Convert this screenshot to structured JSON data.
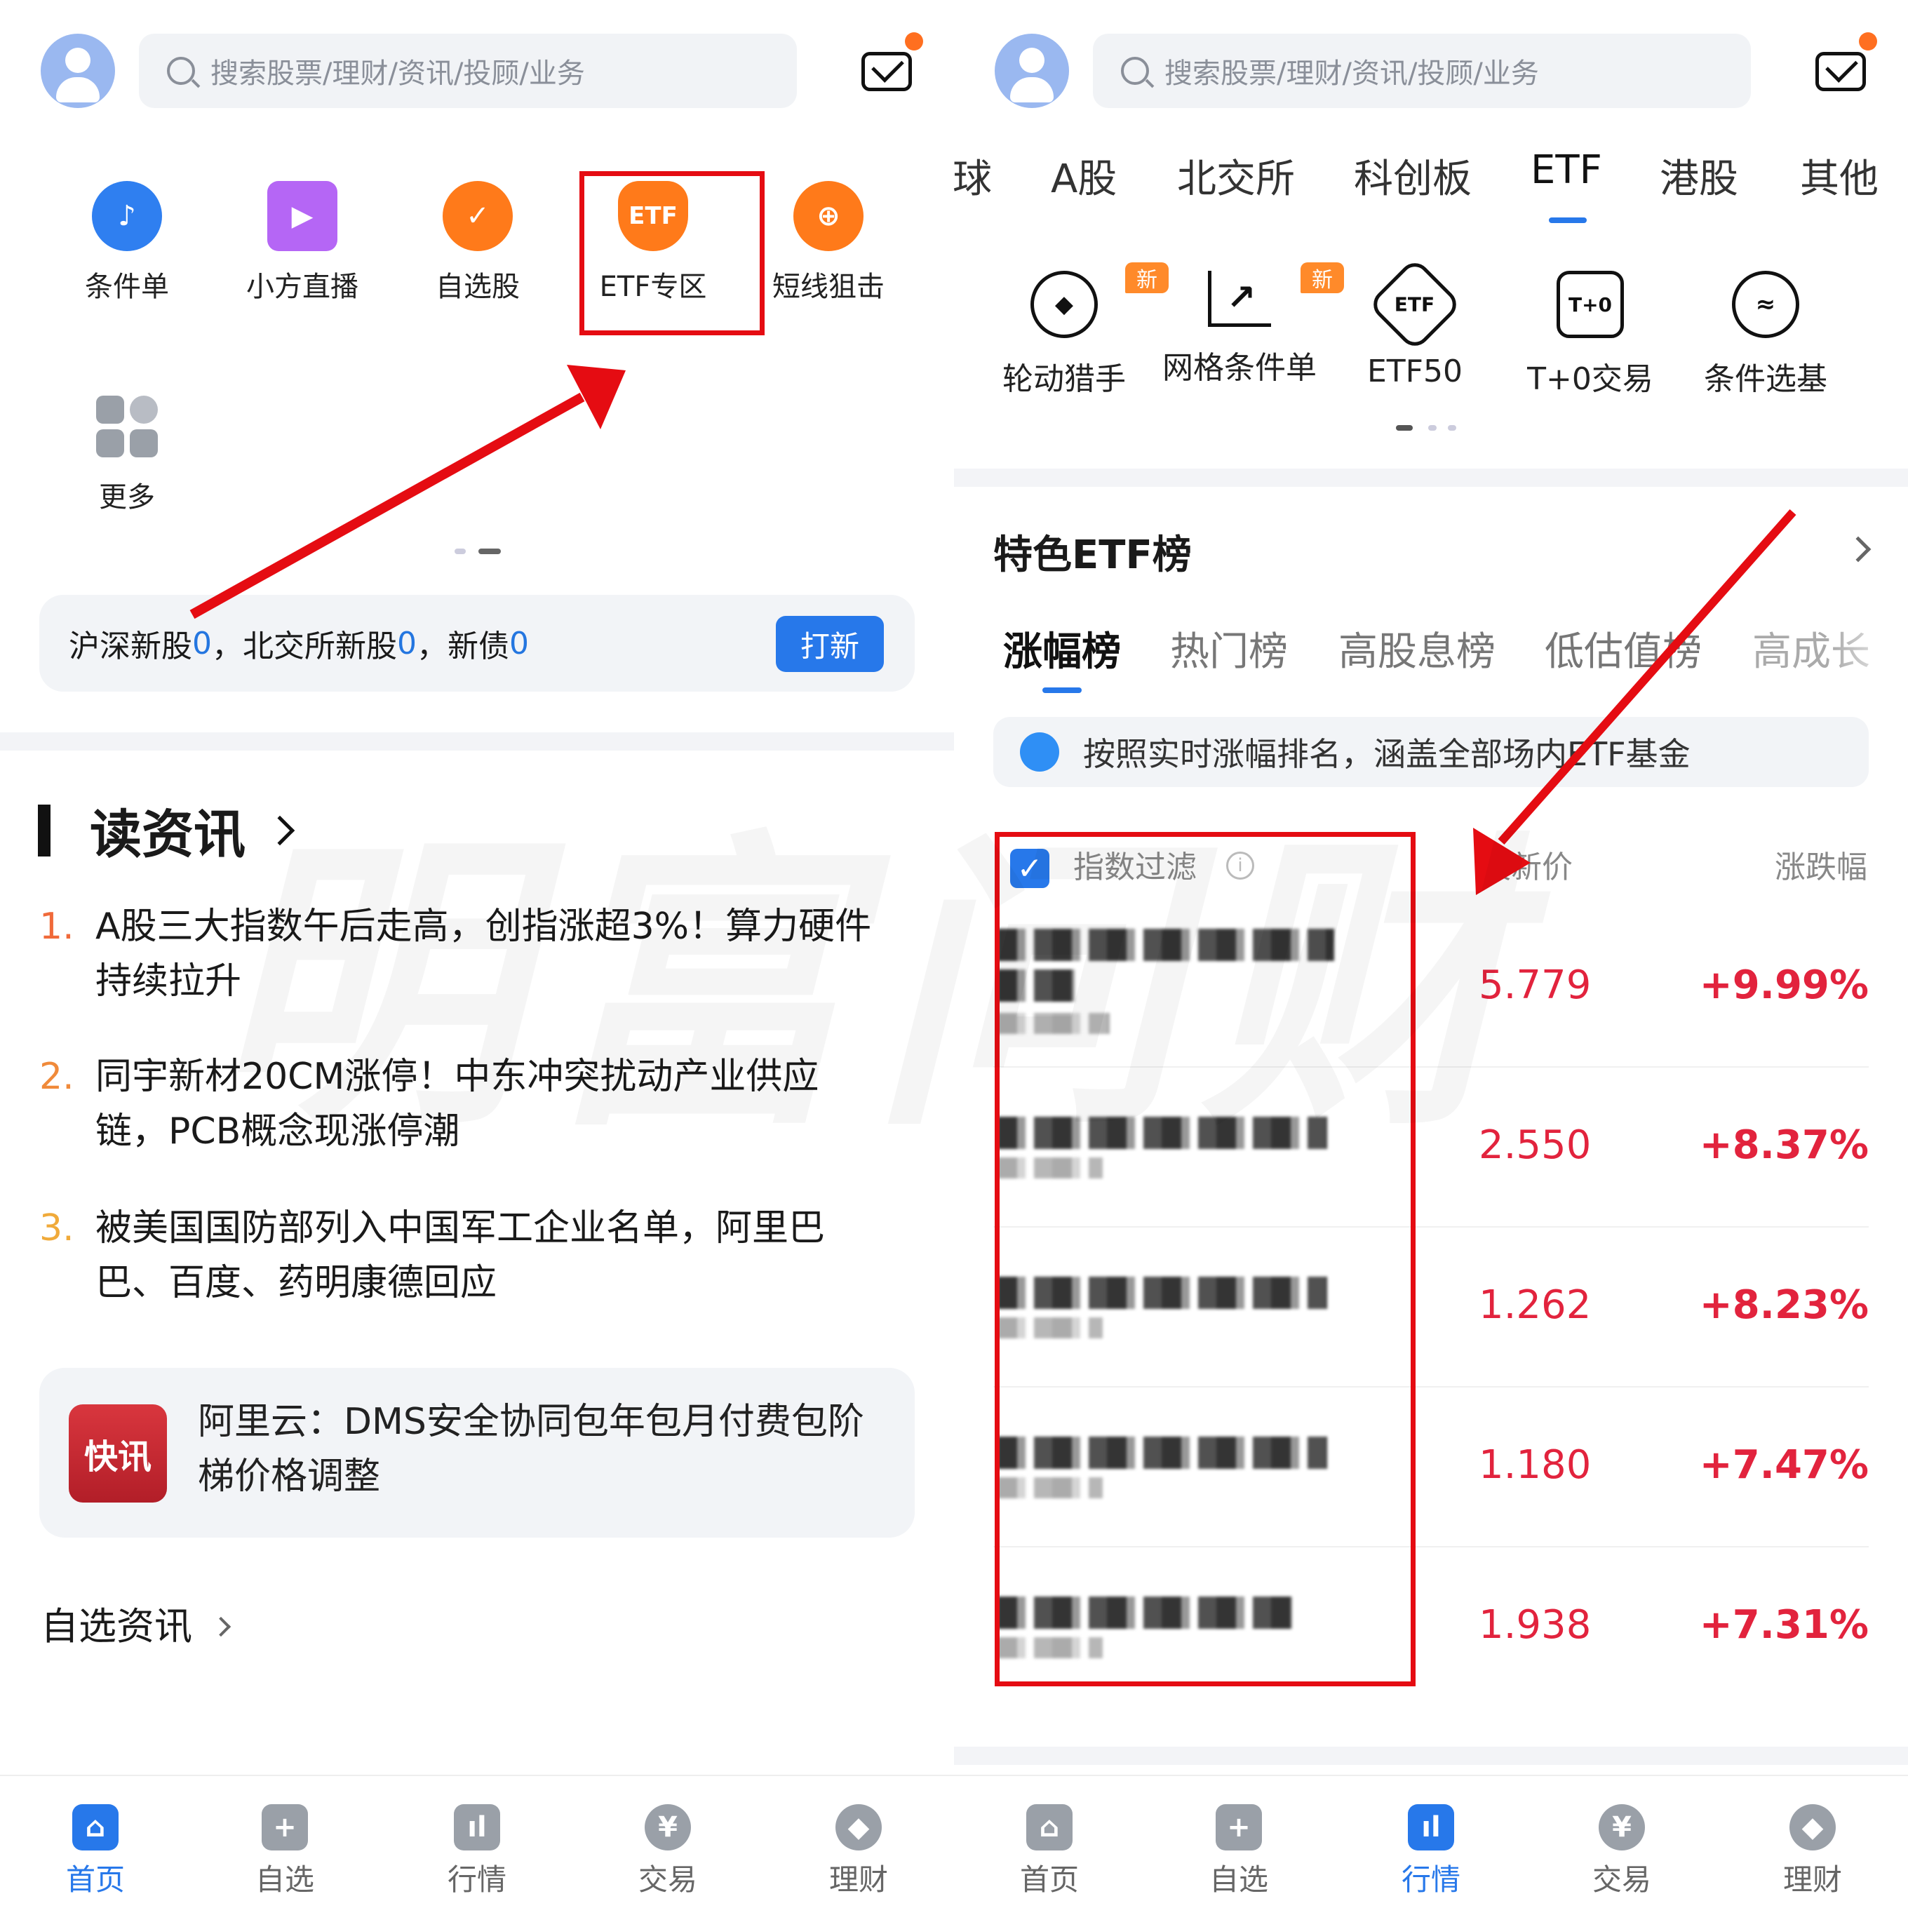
{
  "left": {
    "search_placeholder": "搜索股票/理财/资讯/投顾/业务",
    "shortcuts": [
      {
        "label": "条件单",
        "icon": "clock-icon",
        "color": "#2f7ff0"
      },
      {
        "label": "小方直播",
        "icon": "play-icon",
        "color": "#b566f5"
      },
      {
        "label": "自选股",
        "icon": "heart-icon",
        "color": "#ff7a1a"
      },
      {
        "label": "ETF专区",
        "icon": "etf-icon",
        "color": "#ff7a1a"
      },
      {
        "label": "短线狙击",
        "icon": "target-icon",
        "color": "#ff7a1a"
      },
      {
        "label": "更多",
        "icon": "grid-icon",
        "color": "#b8bcc4"
      }
    ],
    "ipo": {
      "p1": "沪深新股",
      "n1": "0",
      "p2": "，北交所新股",
      "n2": "0",
      "p3": "，新债",
      "n3": "0",
      "button": "打新"
    },
    "news_title": "读资讯",
    "news": [
      {
        "num": "1.",
        "text": "A股三大指数午后走高，创指涨超3%！算力硬件持续拉升",
        "color": "#f06a3a"
      },
      {
        "num": "2.",
        "text": "同宇新材20CM涨停！中东冲突扰动产业供应链，PCB概念现涨停潮",
        "color": "#f08a3a"
      },
      {
        "num": "3.",
        "text": "被美国国防部列入中国军工企业名单，阿里巴巴、百度、药明康德回应",
        "color": "#f0aa3a"
      }
    ],
    "flash_logo": "快讯",
    "flash_text": "阿里云：DMS安全协同包年包月付费包阶梯价格调整",
    "watchlist_news": "自选资讯"
  },
  "right": {
    "search_placeholder": "搜索股票/理财/资讯/投顾/业务",
    "market_tabs": [
      "球",
      "A股",
      "北交所",
      "科创板",
      "ETF",
      "港股",
      "其他"
    ],
    "active_market_tab": "ETF",
    "tools": [
      {
        "label": "轮动猎手",
        "icon": "compass-icon",
        "glyph": "◆",
        "badge": "新"
      },
      {
        "label": "网格条件单",
        "icon": "grid-chart-icon",
        "glyph": "↗",
        "badge": "新"
      },
      {
        "label": "ETF50",
        "icon": "etf50-icon",
        "glyph": "ETF",
        "badge": ""
      },
      {
        "label": "T+0交易",
        "icon": "t0-icon",
        "glyph": "T+0",
        "badge": ""
      },
      {
        "label": "条件选基",
        "icon": "search-chart-icon",
        "glyph": "≈",
        "badge": ""
      }
    ],
    "section_title": "特色ETF榜",
    "rank_tabs": [
      "涨幅榜",
      "热门榜",
      "高股息榜",
      "低估值榜",
      "高成长"
    ],
    "tip": "按照实时涨幅排名，涵盖全部场内ETF基金",
    "header": {
      "filter": "指数过滤",
      "price": "最新价",
      "change": "涨跌幅"
    },
    "rows": [
      {
        "price": "5.779",
        "change": "+9.99%"
      },
      {
        "price": "2.550",
        "change": "+8.37%"
      },
      {
        "price": "1.262",
        "change": "+8.23%"
      },
      {
        "price": "1.180",
        "change": "+7.47%"
      },
      {
        "price": "1.938",
        "change": "+7.31%"
      }
    ]
  },
  "nav": [
    {
      "label": "首页",
      "icon": "home-icon",
      "glyph": "⌂"
    },
    {
      "label": "自选",
      "icon": "plus-square-icon",
      "glyph": "+"
    },
    {
      "label": "行情",
      "icon": "bars-icon",
      "glyph": "ıl"
    },
    {
      "label": "交易",
      "icon": "yen-icon",
      "glyph": "¥"
    },
    {
      "label": "理财",
      "icon": "diamond-icon",
      "glyph": "◆"
    }
  ],
  "left_active_nav": "首页",
  "right_active_nav": "行情",
  "watermark": "明富问财",
  "colors": {
    "accent": "#2778ea",
    "up": "#e2233d",
    "annotation": "#e50c12"
  }
}
